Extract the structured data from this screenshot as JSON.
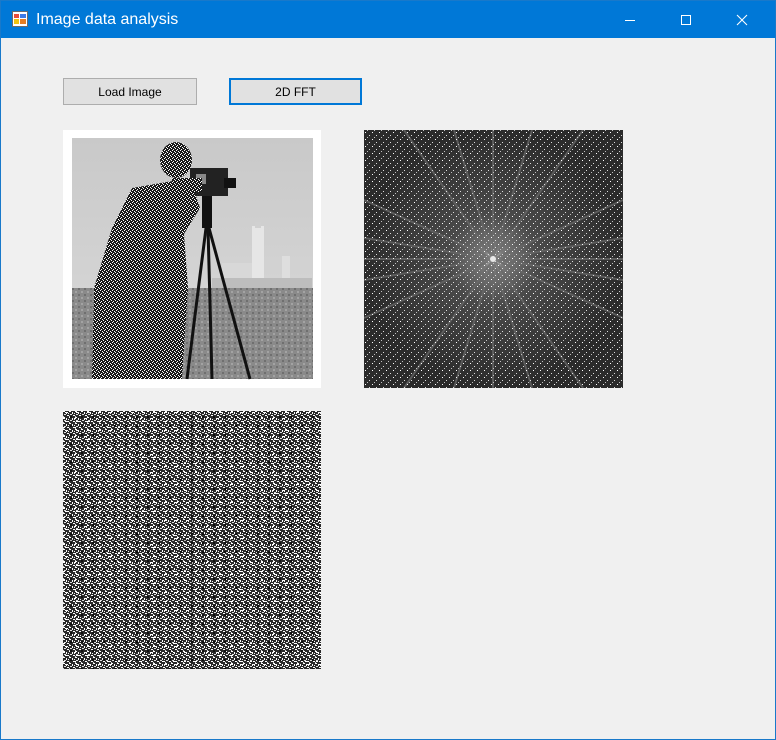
{
  "window": {
    "title": "Image data analysis",
    "icon": "app-icon",
    "controls": [
      "minimize-icon",
      "maximize-icon",
      "close-icon"
    ],
    "accent_color": "#0078d7"
  },
  "toolbar": {
    "load_label": "Load Image",
    "fft_label": "2D FFT"
  },
  "images": {
    "original": {
      "description_icon": "cameraman-photo"
    },
    "spectrum": {
      "description_icon": "fft-magnitude-spectrum"
    },
    "phase": {
      "description_icon": "fft-phase-noise"
    }
  }
}
